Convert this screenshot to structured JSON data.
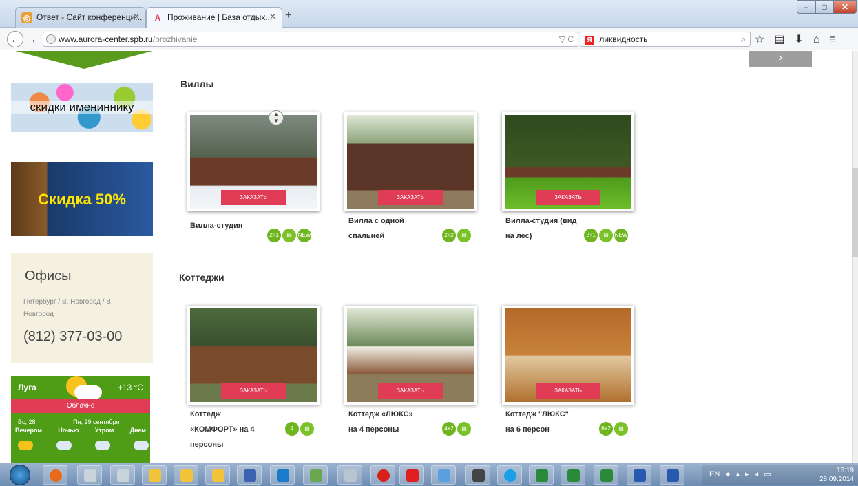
{
  "browser": {
    "tabs": [
      {
        "label": "Ответ - Сайт конференци...",
        "active": false
      },
      {
        "label": "Проживание | База отдых...",
        "active": true
      }
    ],
    "new_tab": "+",
    "url_host": "www.aurora-center.spb.ru",
    "url_path": "/prozhivanie",
    "url_prefix": "www.",
    "search_text": "ликвидность"
  },
  "sidebar": {
    "banner1_text": "скидки имениннику",
    "banner2_text": "Скидка 50%",
    "offices": {
      "title": "Офисы",
      "cities": "Петербург / В. Новгород / В. Новгород",
      "phone": "(812) 377-03-00"
    },
    "weather": {
      "city": "Луга",
      "temp": "+13 °C",
      "condition": "Облачно",
      "day1": "Вс, 28",
      "day2": "Пн, 29 сентября",
      "parts": [
        "Вечером",
        "Ночью",
        "Утром",
        "Днем"
      ]
    }
  },
  "main": {
    "next_arrow": "›",
    "sections": [
      {
        "title": "Виллы",
        "items": [
          {
            "name_line1": "Вилла-студия",
            "name_line2": "",
            "name_line3": "",
            "order": "ЗАКАЗАТЬ",
            "badges": [
              "2+1",
              "menu-icon",
              "NEW"
            ]
          },
          {
            "name_line1": "Вилла с одной",
            "name_line2": "спальней",
            "name_line3": "",
            "order": "ЗАКАЗАТЬ",
            "badges": [
              "2+2",
              "menu-icon"
            ]
          },
          {
            "name_line1": "Вилла-студия (вид",
            "name_line2": "на лес)",
            "name_line3": "",
            "order": "ЗАКАЗАТЬ",
            "badges": [
              "2+1",
              "menu-icon",
              "NEW"
            ]
          }
        ]
      },
      {
        "title": "Коттеджи",
        "items": [
          {
            "name_line1": "Коттедж",
            "name_line2": "«КОМФОРТ» на 4",
            "name_line3": "персоны",
            "order": "ЗАКАЗАТЬ",
            "badges": [
              "4",
              "menu-icon"
            ]
          },
          {
            "name_line1": "Коттедж «ЛЮКС»",
            "name_line2": "на 4 персоны",
            "name_line3": "",
            "order": "ЗАКАЗАТЬ",
            "badges": [
              "4+2",
              "menu-icon"
            ]
          },
          {
            "name_line1": "Коттедж \"ЛЮКС\"",
            "name_line2": "на 6 персон",
            "name_line3": "",
            "order": "ЗАКАЗАТЬ",
            "badges": [
              "6+2",
              "menu-icon"
            ]
          }
        ]
      }
    ]
  },
  "taskbar": {
    "lang": "EN",
    "time": "16:19",
    "date": "28.09.2014"
  }
}
